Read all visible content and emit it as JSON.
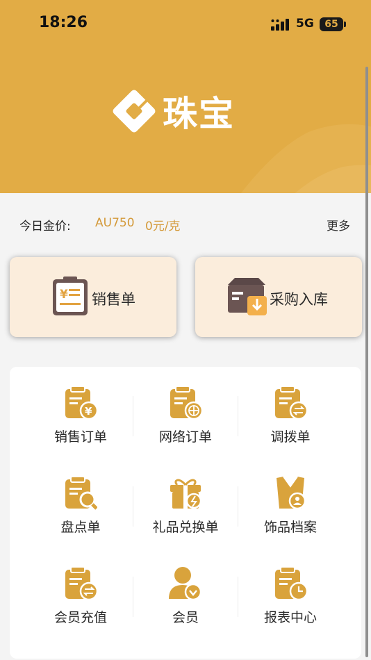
{
  "status_bar": {
    "time": "18:26",
    "network": "5G",
    "battery": "65"
  },
  "header": {
    "brand": "珠宝"
  },
  "gold_price": {
    "label": "今日金价:",
    "code": "AU750",
    "price": "0元/克",
    "more": "更多"
  },
  "quick_actions": [
    {
      "label": "销售单",
      "icon": "receipt-icon"
    },
    {
      "label": "采购入库",
      "icon": "inbound-box-icon"
    }
  ],
  "grid": [
    {
      "label": "销售订单",
      "icon": "sales-order-icon"
    },
    {
      "label": "网络订单",
      "icon": "web-order-icon"
    },
    {
      "label": "调拨单",
      "icon": "transfer-icon"
    },
    {
      "label": "盘点单",
      "icon": "inventory-check-icon"
    },
    {
      "label": "礼品兑换单",
      "icon": "gift-exchange-icon"
    },
    {
      "label": "饰品档案",
      "icon": "jewelry-archive-icon"
    },
    {
      "label": "会员充值",
      "icon": "member-recharge-icon"
    },
    {
      "label": "会员",
      "icon": "member-icon"
    },
    {
      "label": "报表中心",
      "icon": "report-icon"
    }
  ],
  "colors": {
    "header": "#e2ac45",
    "accent": "#d49a3a",
    "card": "#fbeddc",
    "icon_gold": "#d9a33c",
    "icon_dark": "#6b5553"
  }
}
